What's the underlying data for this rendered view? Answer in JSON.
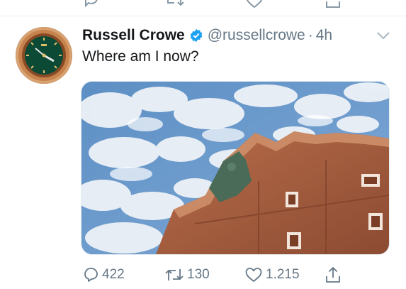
{
  "tweet": {
    "author": {
      "name": "Russell Crowe",
      "verified": true,
      "handle": "@russellcrowe",
      "separator": "·",
      "time": "4h"
    },
    "text": "Where am I now?",
    "media": {
      "icon": "photo-sky-building"
    },
    "actions": {
      "reply_count": "422",
      "retweet_count": "130",
      "like_count": "1.215"
    }
  },
  "colors": {
    "text_primary": "#14171a",
    "text_secondary": "#657786",
    "verified_blue": "#1da1f2",
    "divider": "#e6ecf0"
  }
}
